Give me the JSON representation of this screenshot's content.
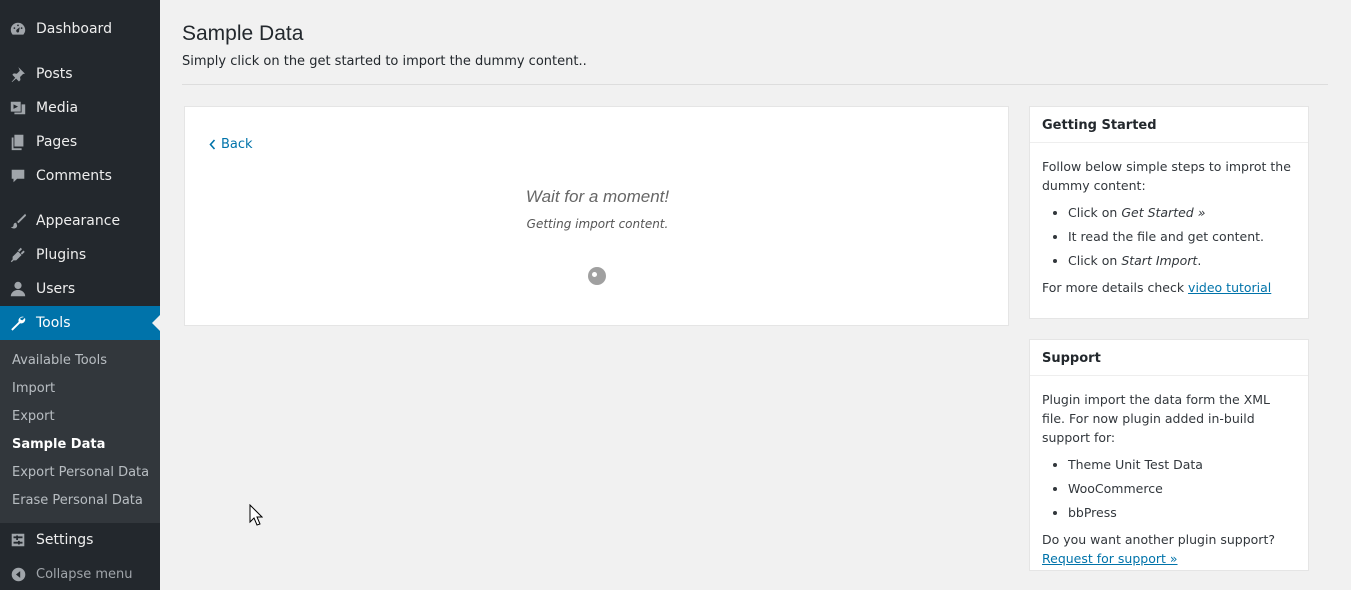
{
  "sidebar": {
    "items": [
      {
        "label": "Dashboard",
        "icon": "dashboard-icon"
      },
      {
        "label": "Posts",
        "icon": "pin-icon"
      },
      {
        "label": "Media",
        "icon": "media-icon"
      },
      {
        "label": "Pages",
        "icon": "pages-icon"
      },
      {
        "label": "Comments",
        "icon": "comments-icon"
      },
      {
        "label": "Appearance",
        "icon": "paintbrush-icon"
      },
      {
        "label": "Plugins",
        "icon": "plugin-icon"
      },
      {
        "label": "Users",
        "icon": "users-icon"
      },
      {
        "label": "Tools",
        "icon": "wrench-icon"
      },
      {
        "label": "Settings",
        "icon": "settings-icon"
      }
    ],
    "submenu": [
      "Available Tools",
      "Import",
      "Export",
      "Sample Data",
      "Export Personal Data",
      "Erase Personal Data"
    ],
    "collapse_label": "Collapse menu"
  },
  "header": {
    "title": "Sample Data",
    "description": "Simply click on the get started to import the dummy content.."
  },
  "main": {
    "back_label": "Back",
    "wait_title": "Wait for a moment!",
    "wait_sub": "Getting import content."
  },
  "getting_started": {
    "title": "Getting Started",
    "intro": "Follow below simple steps to improt the dummy content:",
    "steps": [
      {
        "prefix": "Click on ",
        "em": "Get Started »",
        "suffix": ""
      },
      {
        "prefix": "It read the file and get content.",
        "em": "",
        "suffix": ""
      },
      {
        "prefix": "Click on ",
        "em": "Start Import",
        "suffix": "."
      }
    ],
    "more_prefix": "For more details check ",
    "more_link": "video tutorial"
  },
  "support": {
    "title": "Support",
    "intro": "Plugin import the data form the XML file. For now plugin added in-build support for:",
    "items": [
      "Theme Unit Test Data",
      "WooCommerce",
      "bbPress"
    ],
    "question": "Do you want another plugin support?",
    "link": "Request for support »"
  },
  "colors": {
    "sidebar_bg": "#23282d",
    "active_bg": "#0073aa",
    "link": "#0073aa"
  }
}
